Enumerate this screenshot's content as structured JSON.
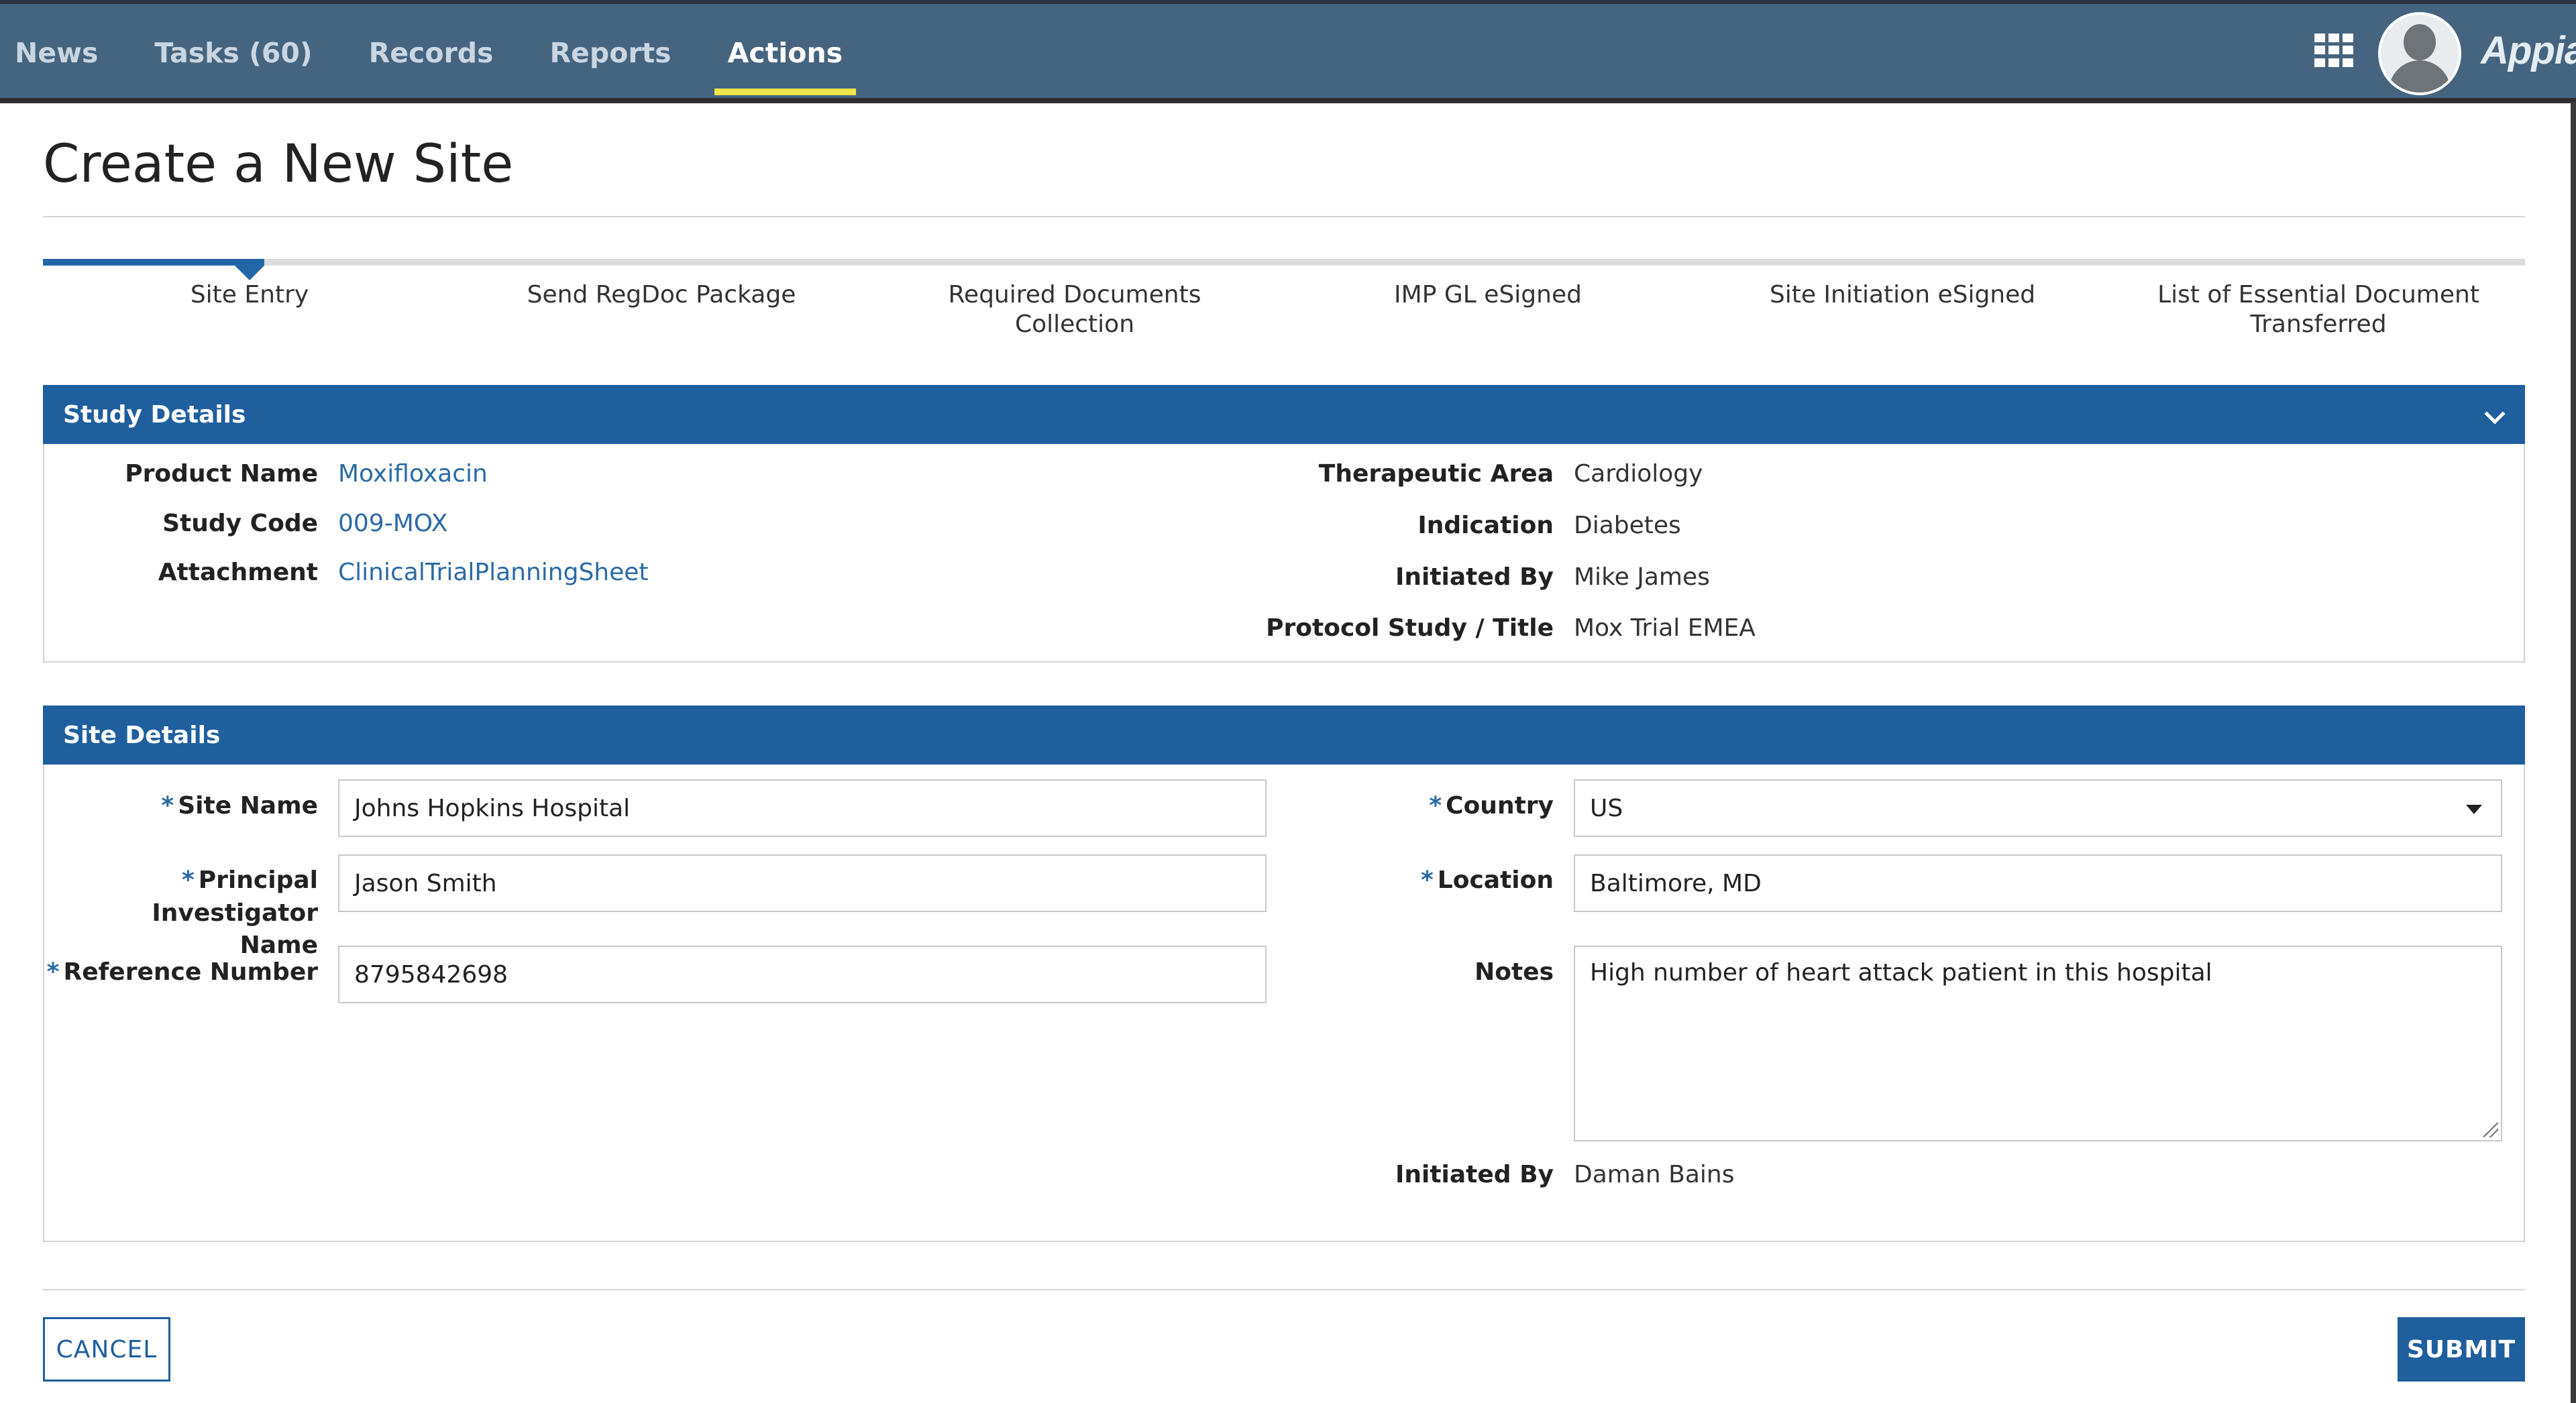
{
  "nav": {
    "tabs": [
      {
        "label": "News"
      },
      {
        "label": "Tasks (60)"
      },
      {
        "label": "Records"
      },
      {
        "label": "Reports"
      },
      {
        "label": "Actions"
      }
    ],
    "active_tab": "Actions",
    "apps_icon": "grid-icon",
    "avatar_icon": "user-avatar-icon",
    "brand": "Appian"
  },
  "page": {
    "title": "Create a New Site"
  },
  "steps": {
    "items": [
      {
        "label": "Site Entry"
      },
      {
        "label": "Send RegDoc Package"
      },
      {
        "label": "Required Documents Collection"
      },
      {
        "label": "IMP GL eSigned"
      },
      {
        "label": "Site Initiation eSigned"
      },
      {
        "label": "List of Essential Document Transferred"
      }
    ],
    "current": "Site Entry"
  },
  "study_details": {
    "title": "Study Details",
    "product_name_label": "Product Name",
    "product_name": "Moxifloxacin",
    "study_code_label": "Study Code",
    "study_code": "009-MOX",
    "attachment_label": "Attachment",
    "attachment": "ClinicalTrialPlanningSheet",
    "therapeutic_area_label": "Therapeutic Area",
    "therapeutic_area": "Cardiology",
    "indication_label": "Indication",
    "indication": "Diabetes",
    "initiated_by_label": "Initiated By",
    "initiated_by": "Mike James",
    "protocol_label": "Protocol Study / Title",
    "protocol": "Mox Trial EMEA"
  },
  "site_details": {
    "title": "Site Details",
    "required_marker": "*",
    "site_name_label": "Site Name",
    "site_name": "Johns Hopkins Hospital",
    "pi_label_line1": "Principal",
    "pi_label_line2": "Investigator Name",
    "pi_name": "Jason Smith",
    "ref_label": "Reference Number",
    "ref_number": "8795842698",
    "country_label": "Country",
    "country": "US",
    "location_label": "Location",
    "location": "Baltimore, MD",
    "notes_label": "Notes",
    "notes": "High number of heart attack patient in this hospital",
    "initiated_by_label": "Initiated By",
    "initiated_by": "Daman Bains"
  },
  "buttons": {
    "cancel": "CANCEL",
    "submit": "SUBMIT"
  },
  "colors": {
    "nav_bg": "#45647f",
    "section_header": "#1f5f9e",
    "link": "#2b6aa6",
    "active_underline": "#f2e44b"
  }
}
